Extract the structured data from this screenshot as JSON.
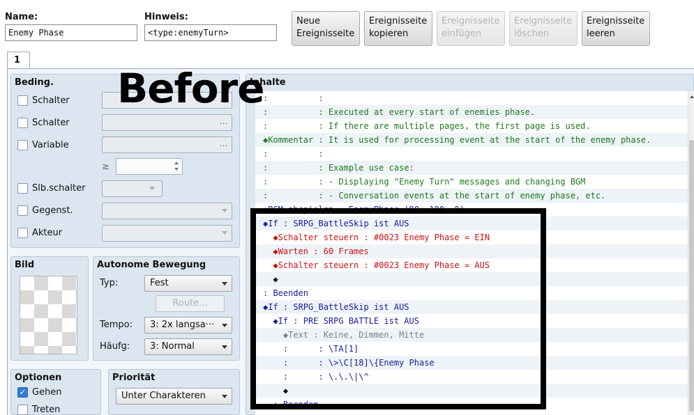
{
  "header": {
    "name_label": "Name:",
    "name_value": "Enemy Phase",
    "note_label": "Hinweis:",
    "note_value": "<type:enemyTurn>"
  },
  "toolbar": {
    "new_page": "Neue\nEreignisseite",
    "copy_page": "Ereignisseite\nkopieren",
    "paste_page": "Ereignisseite\neinfügen",
    "delete_page": "Ereignisseite\nlöschen",
    "clear_page": "Ereignisseite\nleeren"
  },
  "tabs": [
    "1"
  ],
  "conditions": {
    "title": "Beding.",
    "switch1": "Schalter",
    "switch2": "Schalter",
    "variable": "Variable",
    "gte": "≥",
    "self_switch": "Slb.schalter",
    "item": "Gegenst.",
    "actor": "Akteur",
    "ellipsis": "…"
  },
  "image": {
    "title": "Bild"
  },
  "autonomous": {
    "title": "Autonome Bewegung",
    "type_label": "Typ:",
    "type_value": "Fest",
    "route_label": "Route...",
    "speed_label": "Tempo:",
    "speed_value": "3: 2x langsa···",
    "freq_label": "Häufg:",
    "freq_value": "3: Normal"
  },
  "options": {
    "title": "Optionen",
    "walking": "Gehen",
    "walking_checked": true,
    "stepping": "Treten"
  },
  "priority": {
    "title": "Priorität",
    "value": "Unter Charakteren"
  },
  "contents": {
    "title": "Inhalte",
    "lines": [
      {
        "text": ":          :",
        "color": "#1a7a1a"
      },
      {
        "text": ":          : Executed at every start of enemies phase.",
        "color": "#1a7a1a"
      },
      {
        "text": ":          : If there are multiple pages, the first page is used.",
        "color": "#1a7a1a"
      },
      {
        "text": "◆Kommentar : It is used for processing event at the start of the enemy phase.",
        "color": "#1a7a1a"
      },
      {
        "text": ":          :",
        "color": "#1a7a1a"
      },
      {
        "text": ":          : Example use case:",
        "color": "#1a7a1a"
      },
      {
        "text": ":          : - Displaying \"Enemy Turn\" messages and changing BGM",
        "color": "#1a7a1a"
      },
      {
        "text": ":          : - Conversation events at the start of enemy phase, etc.",
        "color": "#1a7a1a"
      },
      {
        "text": "◆BGM abspielen : EnemyPhase (90, 100, 0)",
        "color": "#1a1aa0"
      },
      {
        "text": "◆If : SRPG_BattleSkip ist AUS",
        "color": "#1a1aa0"
      },
      {
        "text": "  ◆Schalter steuern : #0023 Enemy Phase = EIN",
        "color": "#d01010"
      },
      {
        "text": "  ◆Warten : 60 Frames",
        "color": "#d01010"
      },
      {
        "text": "  ◆Schalter steuern : #0023 Enemy Phase = AUS",
        "color": "#d01010"
      },
      {
        "text": "  ◆",
        "color": "#111111"
      },
      {
        "text": ": Beenden",
        "color": "#1a1aa0"
      },
      {
        "text": "◆If : SRPG_BattleSkip ist AUS",
        "color": "#1a1aa0"
      },
      {
        "text": "  ◆If : PRE SRPG BATTLE ist AUS",
        "color": "#1a1aa0"
      },
      {
        "text": "    ◆Text : Keine, Dimmen, Mitte",
        "color": "#808080"
      },
      {
        "text": "    :      : \\TA[1]",
        "color": "#1a1aa0"
      },
      {
        "text": "    :      : \\>\\C[18]\\{Enemy Phase",
        "color": "#1a1aa0"
      },
      {
        "text": "    :      : \\.\\.\\|\\^",
        "color": "#1a1aa0"
      },
      {
        "text": "    ◆",
        "color": "#111111"
      },
      {
        "text": "  : Beenden",
        "color": "#1a1aa0"
      }
    ]
  },
  "overlay": {
    "before_label": "Before"
  },
  "colors": {
    "panel_bg": "#dce6f1",
    "comment_green": "#1a7a1a",
    "command_blue": "#1a1aa0",
    "switch_red": "#d01010"
  }
}
